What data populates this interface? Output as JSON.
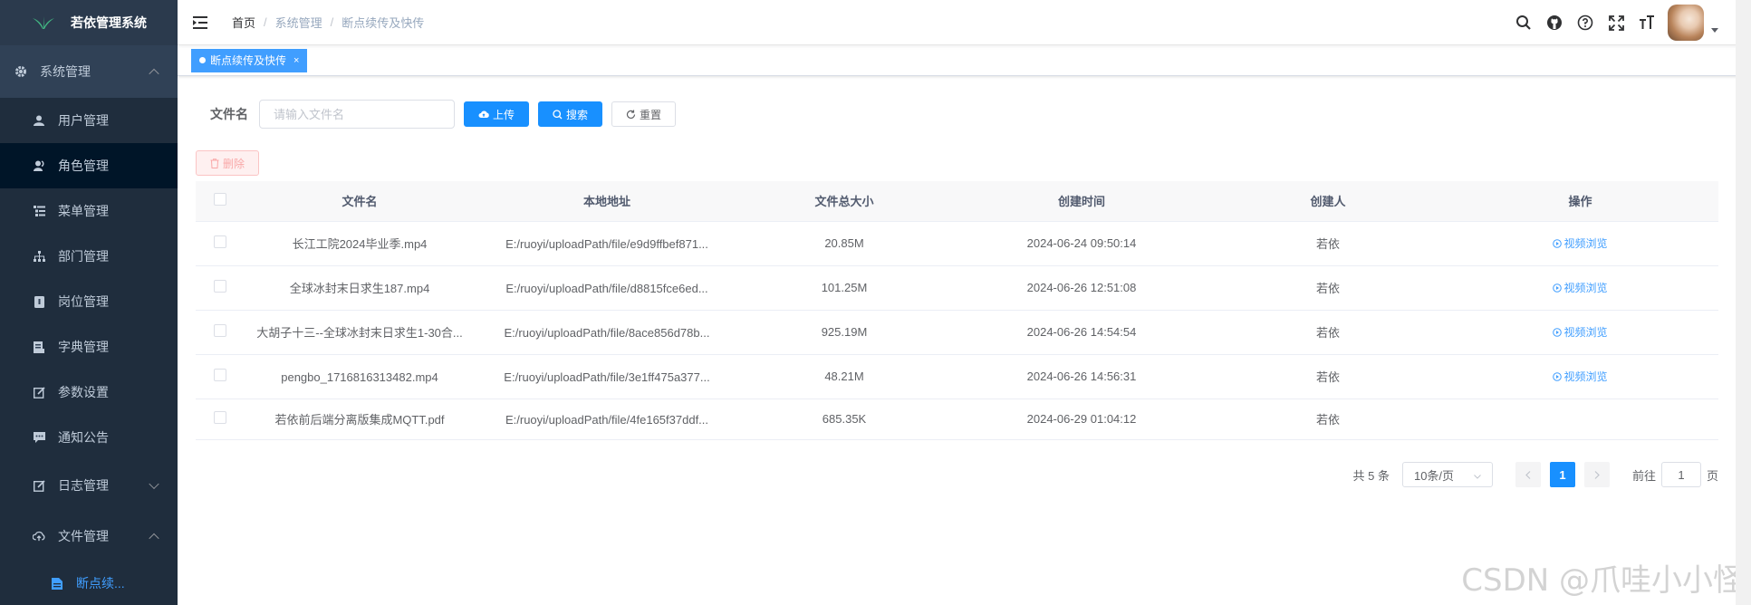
{
  "app": {
    "title": "若依管理系统"
  },
  "sidebar": {
    "groups": [
      {
        "label": "系统管理",
        "icon": "gear-icon",
        "expanded": true
      }
    ],
    "items": [
      {
        "label": "用户管理",
        "icon": "user-icon"
      },
      {
        "label": "角色管理",
        "icon": "peoples-icon",
        "active": true
      },
      {
        "label": "菜单管理",
        "icon": "tree-table-icon"
      },
      {
        "label": "部门管理",
        "icon": "tree-icon"
      },
      {
        "label": "岗位管理",
        "icon": "post-icon"
      },
      {
        "label": "字典管理",
        "icon": "dict-icon"
      },
      {
        "label": "参数设置",
        "icon": "edit-icon"
      },
      {
        "label": "通知公告",
        "icon": "message-icon"
      },
      {
        "label": "日志管理",
        "icon": "log-icon"
      },
      {
        "label": "文件管理",
        "icon": "upload-icon"
      },
      {
        "label": "断点续...",
        "icon": "documentation-icon"
      }
    ]
  },
  "navbar": {
    "breadcrumb": [
      "首页",
      "系统管理",
      "断点续传及快传"
    ],
    "icons": [
      "search-icon",
      "github-icon",
      "question-icon",
      "fullscreen-icon",
      "font-size-icon"
    ]
  },
  "tags": [
    {
      "label": "断点续传及快传",
      "active": true,
      "close": "×"
    }
  ],
  "search": {
    "label": "文件名",
    "placeholder": "请输入文件名",
    "upload": "上传",
    "search": "搜索",
    "reset": "重置"
  },
  "toolbar": {
    "delete": "删除"
  },
  "table": {
    "headers": [
      "文件名",
      "本地地址",
      "文件总大小",
      "创建时间",
      "创建人",
      "操作"
    ],
    "rows": [
      {
        "name": "长江工院2024毕业季.mp4",
        "path": "E:/ruoyi/uploadPath/file/e9d9ffbef871...",
        "size": "20.85M",
        "time": "2024-06-24 09:50:14",
        "creator": "若依",
        "action": "视频浏览"
      },
      {
        "name": "全球冰封末日求生187.mp4",
        "path": "E:/ruoyi/uploadPath/file/d8815fce6ed...",
        "size": "101.25M",
        "time": "2024-06-26 12:51:08",
        "creator": "若依",
        "action": "视频浏览"
      },
      {
        "name": "大胡子十三--全球冰封末日求生1-30合...",
        "path": "E:/ruoyi/uploadPath/file/8ace856d78b...",
        "size": "925.19M",
        "time": "2024-06-26 14:54:54",
        "creator": "若依",
        "action": "视频浏览"
      },
      {
        "name": "pengbo_1716816313482.mp4",
        "path": "E:/ruoyi/uploadPath/file/3e1ff475a377...",
        "size": "48.21M",
        "time": "2024-06-26 14:56:31",
        "creator": "若依",
        "action": "视频浏览"
      },
      {
        "name": "若依前后端分离版集成MQTT.pdf",
        "path": "E:/ruoyi/uploadPath/file/4fe165f37ddf...",
        "size": "685.35K",
        "time": "2024-06-29 01:04:12",
        "creator": "若依",
        "action": ""
      }
    ]
  },
  "pagination": {
    "total": "共 5 条",
    "page_size": "10条/页",
    "current": "1",
    "goto_prefix": "前往",
    "goto_value": "1",
    "goto_suffix": "页"
  },
  "watermark": "CSDN @爪哇小小怪",
  "colors": {
    "primary": "#1890ff",
    "sidebar": "#304156",
    "link": "#409eff"
  }
}
